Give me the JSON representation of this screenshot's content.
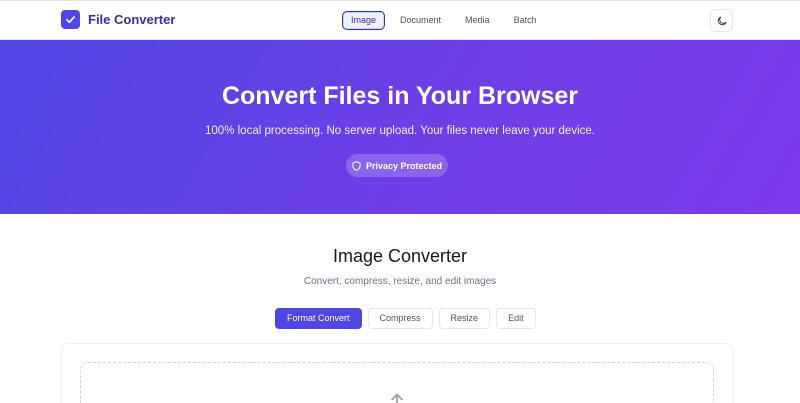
{
  "header": {
    "brand": "File Converter",
    "nav": [
      "Image",
      "Document",
      "Media",
      "Batch"
    ],
    "active_nav": "Image"
  },
  "hero": {
    "title": "Convert Files in Your Browser",
    "subtitle": "100% local processing. No server upload. Your files never leave your device.",
    "badge": "Privacy Protected"
  },
  "converter": {
    "title": "Image Converter",
    "subtitle": "Convert, compress, resize, and edit images",
    "tabs": [
      "Format Convert",
      "Compress",
      "Resize",
      "Edit"
    ],
    "active_tab": "Format Convert"
  },
  "icons": {
    "logo": "check-icon",
    "theme": "moon-icon",
    "badge": "shield-icon",
    "upload": "arrow-up-icon"
  },
  "colors": {
    "accent": "#4f46e5",
    "hero_start": "#4f46e5",
    "hero_end": "#7c3aed"
  }
}
